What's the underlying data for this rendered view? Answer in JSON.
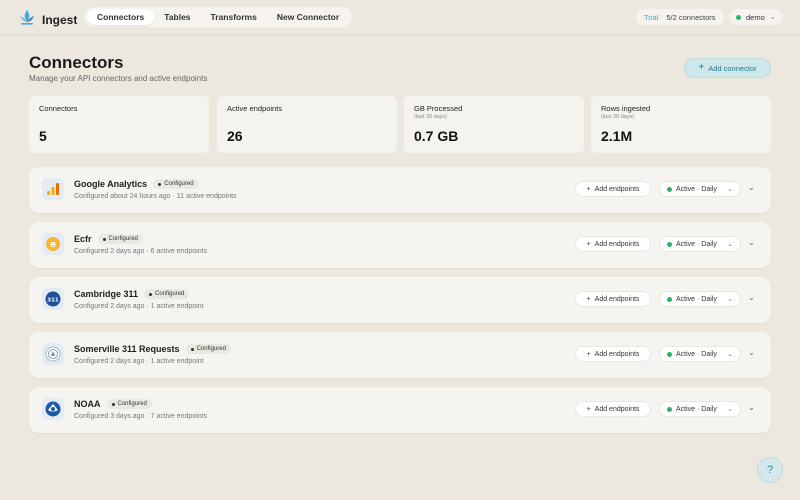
{
  "app": {
    "name": "Ingest"
  },
  "nav": {
    "tabs": [
      {
        "label": "Connectors"
      },
      {
        "label": "Tables"
      },
      {
        "label": "Transforms"
      },
      {
        "label": "New Connector"
      }
    ]
  },
  "trial": {
    "label": "Trial",
    "count": "5/2 connectors"
  },
  "account": {
    "name": "demo"
  },
  "header": {
    "title": "Connectors",
    "subtitle": "Manage your API connectors and active endpoints",
    "add_label": "Add connector"
  },
  "stats": [
    {
      "label": "Connectors",
      "sub": "",
      "value": "5"
    },
    {
      "label": "Active endpoints",
      "sub": "",
      "value": "26"
    },
    {
      "label": "GB Processed",
      "sub": "(last 30 days)",
      "value": "0.7 GB"
    },
    {
      "label": "Rows ingested",
      "sub": "(last 30 days)",
      "value": "2.1M"
    }
  ],
  "connectors": [
    {
      "name": "Google Analytics",
      "badge": "Configured",
      "meta": "Configured about 24 hours ago · 11 active endpoints",
      "add_label": "Add endpoints",
      "status": "Active · Daily",
      "icon": "google-analytics-icon"
    },
    {
      "name": "Ecfr",
      "badge": "Configured",
      "meta": "Configured 2 days ago · 6 active endpoints",
      "add_label": "Add endpoints",
      "status": "Active · Daily",
      "icon": "ecfr-icon"
    },
    {
      "name": "Cambridge 311",
      "badge": "Configured",
      "meta": "Configured 2 days ago · 1 active endpoint",
      "add_label": "Add endpoints",
      "status": "Active · Daily",
      "icon": "cambridge-311-icon"
    },
    {
      "name": "Somerville 311 Requests",
      "badge": "Configured",
      "meta": "Configured 2 days ago · 1 active endpoint",
      "add_label": "Add endpoints",
      "status": "Active · Daily",
      "icon": "somerville-311-icon"
    },
    {
      "name": "NOAA",
      "badge": "Configured",
      "meta": "Configured 3 days ago · 7 active endpoints",
      "add_label": "Add endpoints",
      "status": "Active · Daily",
      "icon": "noaa-icon"
    }
  ],
  "colors": {
    "accent": "#3ba8c7",
    "status_green": "#2bb36b",
    "background": "#ece7df"
  }
}
